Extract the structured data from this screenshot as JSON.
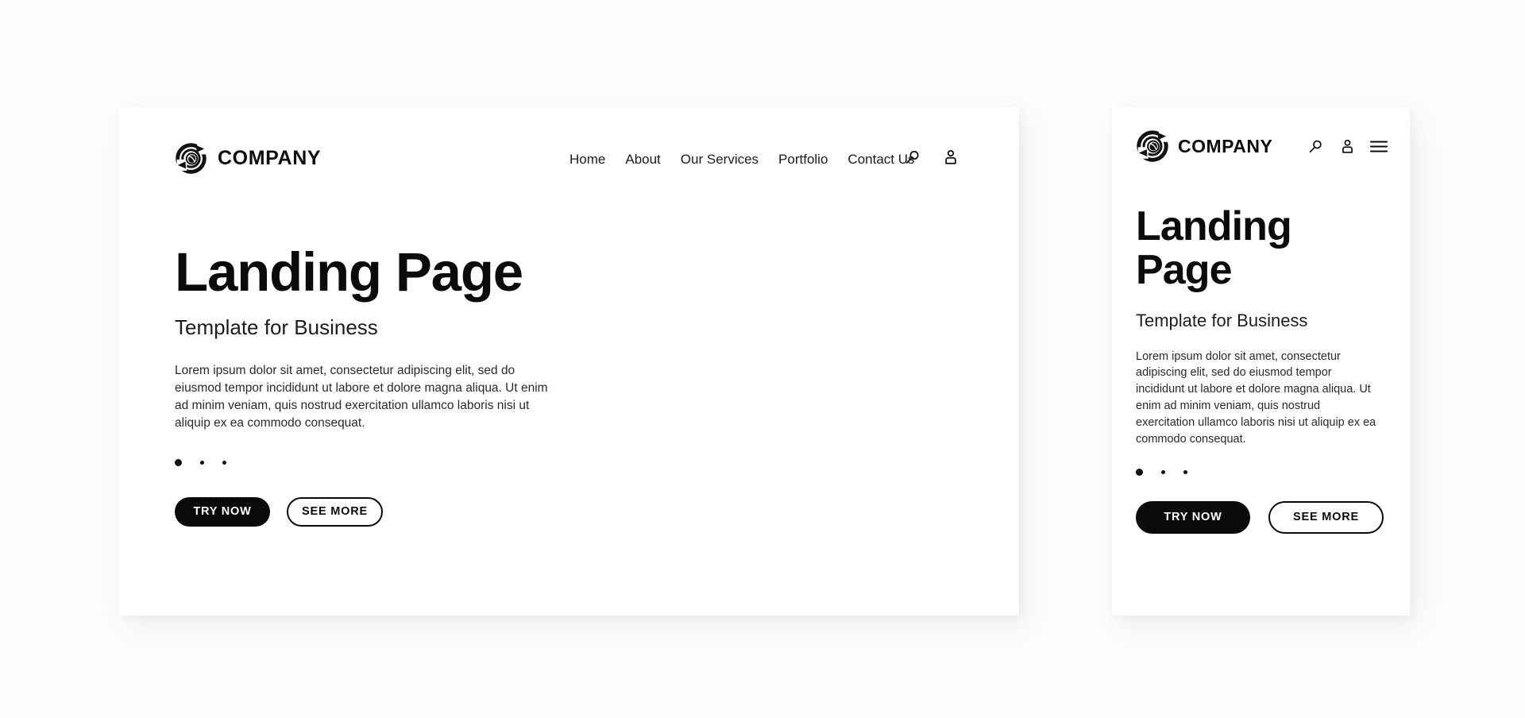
{
  "brand": {
    "name": "COMPANY",
    "logo_icon": "swirl-circle-logo-icon"
  },
  "desktop": {
    "nav": [
      {
        "label": "Home"
      },
      {
        "label": "About"
      },
      {
        "label": "Our Services"
      },
      {
        "label": "Portfolio"
      },
      {
        "label": "Contact Us"
      }
    ],
    "actions": [
      {
        "icon": "search-icon"
      },
      {
        "icon": "user-icon"
      }
    ],
    "hero": {
      "title": "Landing Page",
      "subtitle": "Template for Business",
      "body": "Lorem ipsum dolor sit amet, consectetur adipiscing elit, sed do eiusmod tempor incididunt ut labore et dolore magna aliqua. Ut enim ad minim veniam, quis nostrud exercitation ullamco laboris nisi ut aliquip ex ea commodo consequat."
    },
    "carousel": {
      "total": 3,
      "active": 1
    },
    "buttons": {
      "primary": "TRY NOW",
      "secondary": "SEE MORE"
    }
  },
  "mobile": {
    "actions": [
      {
        "icon": "search-icon"
      },
      {
        "icon": "user-icon"
      },
      {
        "icon": "hamburger-menu-icon"
      }
    ],
    "hero": {
      "title": "Landing Page",
      "subtitle": "Template for Business",
      "body": "Lorem ipsum dolor sit amet, consectetur adipiscing elit, sed do eiusmod tempor incididunt ut labore et dolore magna aliqua. Ut enim ad minim veniam, quis nostrud exercitation ullamco laboris nisi ut aliquip ex ea commodo consequat."
    },
    "carousel": {
      "total": 3,
      "active": 1
    },
    "buttons": {
      "primary": "TRY NOW",
      "secondary": "SEE MORE"
    }
  },
  "colors": {
    "ink": "#0a0a0a",
    "canvas": "#fcfcfc",
    "card": "#ffffff"
  }
}
